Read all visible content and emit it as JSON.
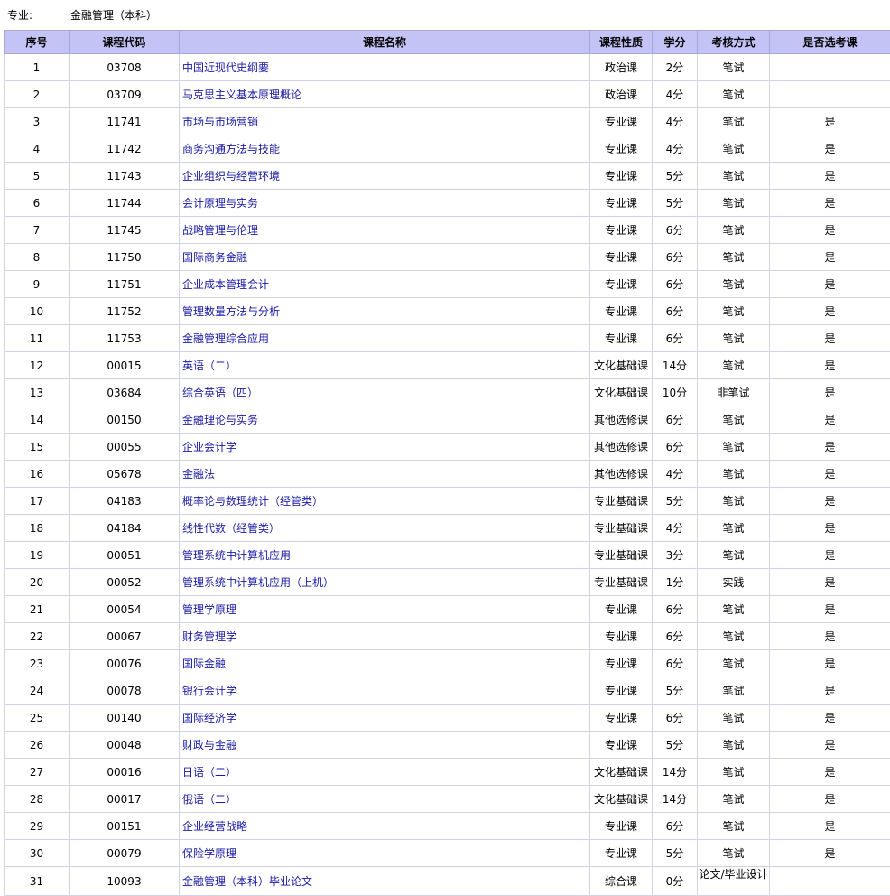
{
  "major": {
    "label": "专业:",
    "value": "金融管理（本科）"
  },
  "headers": [
    "序号",
    "课程代码",
    "课程名称",
    "课程性质",
    "学分",
    "考核方式",
    "是否选考课"
  ],
  "rows": [
    {
      "no": "1",
      "code": "03708",
      "name": "中国近现代史纲要",
      "type": "政治课",
      "credit": "2分",
      "exam": "笔试",
      "optional": ""
    },
    {
      "no": "2",
      "code": "03709",
      "name": "马克思主义基本原理概论",
      "type": "政治课",
      "credit": "4分",
      "exam": "笔试",
      "optional": ""
    },
    {
      "no": "3",
      "code": "11741",
      "name": "市场与市场营销",
      "type": "专业课",
      "credit": "4分",
      "exam": "笔试",
      "optional": "是"
    },
    {
      "no": "4",
      "code": "11742",
      "name": "商务沟通方法与技能",
      "type": "专业课",
      "credit": "4分",
      "exam": "笔试",
      "optional": "是"
    },
    {
      "no": "5",
      "code": "11743",
      "name": "企业组织与经营环境",
      "type": "专业课",
      "credit": "5分",
      "exam": "笔试",
      "optional": "是"
    },
    {
      "no": "6",
      "code": "11744",
      "name": "会计原理与实务",
      "type": "专业课",
      "credit": "5分",
      "exam": "笔试",
      "optional": "是"
    },
    {
      "no": "7",
      "code": "11745",
      "name": "战略管理与伦理",
      "type": "专业课",
      "credit": "6分",
      "exam": "笔试",
      "optional": "是"
    },
    {
      "no": "8",
      "code": "11750",
      "name": "国际商务金融",
      "type": "专业课",
      "credit": "6分",
      "exam": "笔试",
      "optional": "是"
    },
    {
      "no": "9",
      "code": "11751",
      "name": "企业成本管理会计",
      "type": "专业课",
      "credit": "6分",
      "exam": "笔试",
      "optional": "是"
    },
    {
      "no": "10",
      "code": "11752",
      "name": "管理数量方法与分析",
      "type": "专业课",
      "credit": "6分",
      "exam": "笔试",
      "optional": "是"
    },
    {
      "no": "11",
      "code": "11753",
      "name": "金融管理综合应用",
      "type": "专业课",
      "credit": "6分",
      "exam": "笔试",
      "optional": "是"
    },
    {
      "no": "12",
      "code": "00015",
      "name": "英语（二）",
      "type": "文化基础课",
      "credit": "14分",
      "exam": "笔试",
      "optional": "是"
    },
    {
      "no": "13",
      "code": "03684",
      "name": "综合英语（四）",
      "type": "文化基础课",
      "credit": "10分",
      "exam": "非笔试",
      "optional": "是"
    },
    {
      "no": "14",
      "code": "00150",
      "name": "金融理论与实务",
      "type": "其他选修课",
      "credit": "6分",
      "exam": "笔试",
      "optional": "是"
    },
    {
      "no": "15",
      "code": "00055",
      "name": "企业会计学",
      "type": "其他选修课",
      "credit": "6分",
      "exam": "笔试",
      "optional": "是"
    },
    {
      "no": "16",
      "code": "05678",
      "name": "金融法",
      "type": "其他选修课",
      "credit": "4分",
      "exam": "笔试",
      "optional": "是"
    },
    {
      "no": "17",
      "code": "04183",
      "name": "概率论与数理统计（经管类）",
      "type": "专业基础课",
      "credit": "5分",
      "exam": "笔试",
      "optional": "是"
    },
    {
      "no": "18",
      "code": "04184",
      "name": "线性代数（经管类）",
      "type": "专业基础课",
      "credit": "4分",
      "exam": "笔试",
      "optional": "是"
    },
    {
      "no": "19",
      "code": "00051",
      "name": "管理系统中计算机应用",
      "type": "专业基础课",
      "credit": "3分",
      "exam": "笔试",
      "optional": "是"
    },
    {
      "no": "20",
      "code": "00052",
      "name": "管理系统中计算机应用（上机）",
      "type": "专业基础课",
      "credit": "1分",
      "exam": "实践",
      "optional": "是"
    },
    {
      "no": "21",
      "code": "00054",
      "name": "管理学原理",
      "type": "专业课",
      "credit": "6分",
      "exam": "笔试",
      "optional": "是"
    },
    {
      "no": "22",
      "code": "00067",
      "name": "财务管理学",
      "type": "专业课",
      "credit": "6分",
      "exam": "笔试",
      "optional": "是"
    },
    {
      "no": "23",
      "code": "00076",
      "name": "国际金融",
      "type": "专业课",
      "credit": "6分",
      "exam": "笔试",
      "optional": "是"
    },
    {
      "no": "24",
      "code": "00078",
      "name": "银行会计学",
      "type": "专业课",
      "credit": "5分",
      "exam": "笔试",
      "optional": "是"
    },
    {
      "no": "25",
      "code": "00140",
      "name": "国际经济学",
      "type": "专业课",
      "credit": "6分",
      "exam": "笔试",
      "optional": "是"
    },
    {
      "no": "26",
      "code": "00048",
      "name": "财政与金融",
      "type": "专业课",
      "credit": "5分",
      "exam": "笔试",
      "optional": "是"
    },
    {
      "no": "27",
      "code": "00016",
      "name": "日语（二）",
      "type": "文化基础课",
      "credit": "14分",
      "exam": "笔试",
      "optional": "是"
    },
    {
      "no": "28",
      "code": "00017",
      "name": "俄语（二）",
      "type": "文化基础课",
      "credit": "14分",
      "exam": "笔试",
      "optional": "是"
    },
    {
      "no": "29",
      "code": "00151",
      "name": "企业经营战略",
      "type": "专业课",
      "credit": "6分",
      "exam": "笔试",
      "optional": "是"
    },
    {
      "no": "30",
      "code": "00079",
      "name": "保险学原理",
      "type": "专业课",
      "credit": "5分",
      "exam": "笔试",
      "optional": "是"
    },
    {
      "no": "31",
      "code": "10093",
      "name": "金融管理（本科）毕业论文",
      "type": "综合课",
      "credit": "0分",
      "exam": "论文/毕业设计",
      "optional": ""
    }
  ]
}
